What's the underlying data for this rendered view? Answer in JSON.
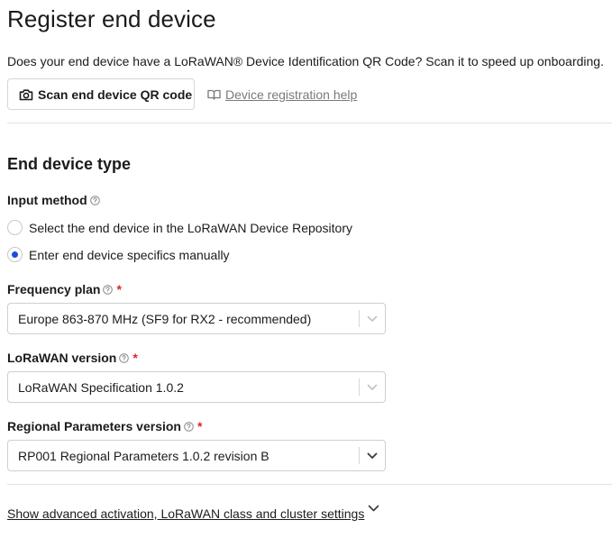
{
  "page": {
    "title": "Register end device",
    "intro": "Does your end device have a LoRaWAN® Device Identification QR Code? Scan it to speed up onboarding."
  },
  "toolbar": {
    "scan_label": "Scan end device QR code",
    "scan_icon": "camera-icon",
    "help_label": "Device registration help",
    "help_icon": "book-icon"
  },
  "section": {
    "title": "End device type"
  },
  "input_method": {
    "label": "Input method",
    "options": [
      {
        "label": "Select the end device in the LoRaWAN Device Repository",
        "checked": false
      },
      {
        "label": "Enter end device specifics manually",
        "checked": true
      }
    ]
  },
  "fields": {
    "frequency_plan": {
      "label": "Frequency plan",
      "required": "*",
      "value": "Europe 863-870 MHz (SF9 for RX2 - recommended)"
    },
    "lorawan_version": {
      "label": "LoRaWAN version",
      "required": "*",
      "value": "LoRaWAN Specification 1.0.2"
    },
    "regional_params": {
      "label": "Regional Parameters version",
      "required": "*",
      "value": "RP001 Regional Parameters 1.0.2 revision B"
    }
  },
  "advanced": {
    "label": "Show advanced activation, LoRaWAN class and cluster settings"
  },
  "colors": {
    "accent": "#1d4ed8",
    "required": "#db2828",
    "muted_link": "#7a7a7a",
    "border": "#cfcfcf"
  }
}
